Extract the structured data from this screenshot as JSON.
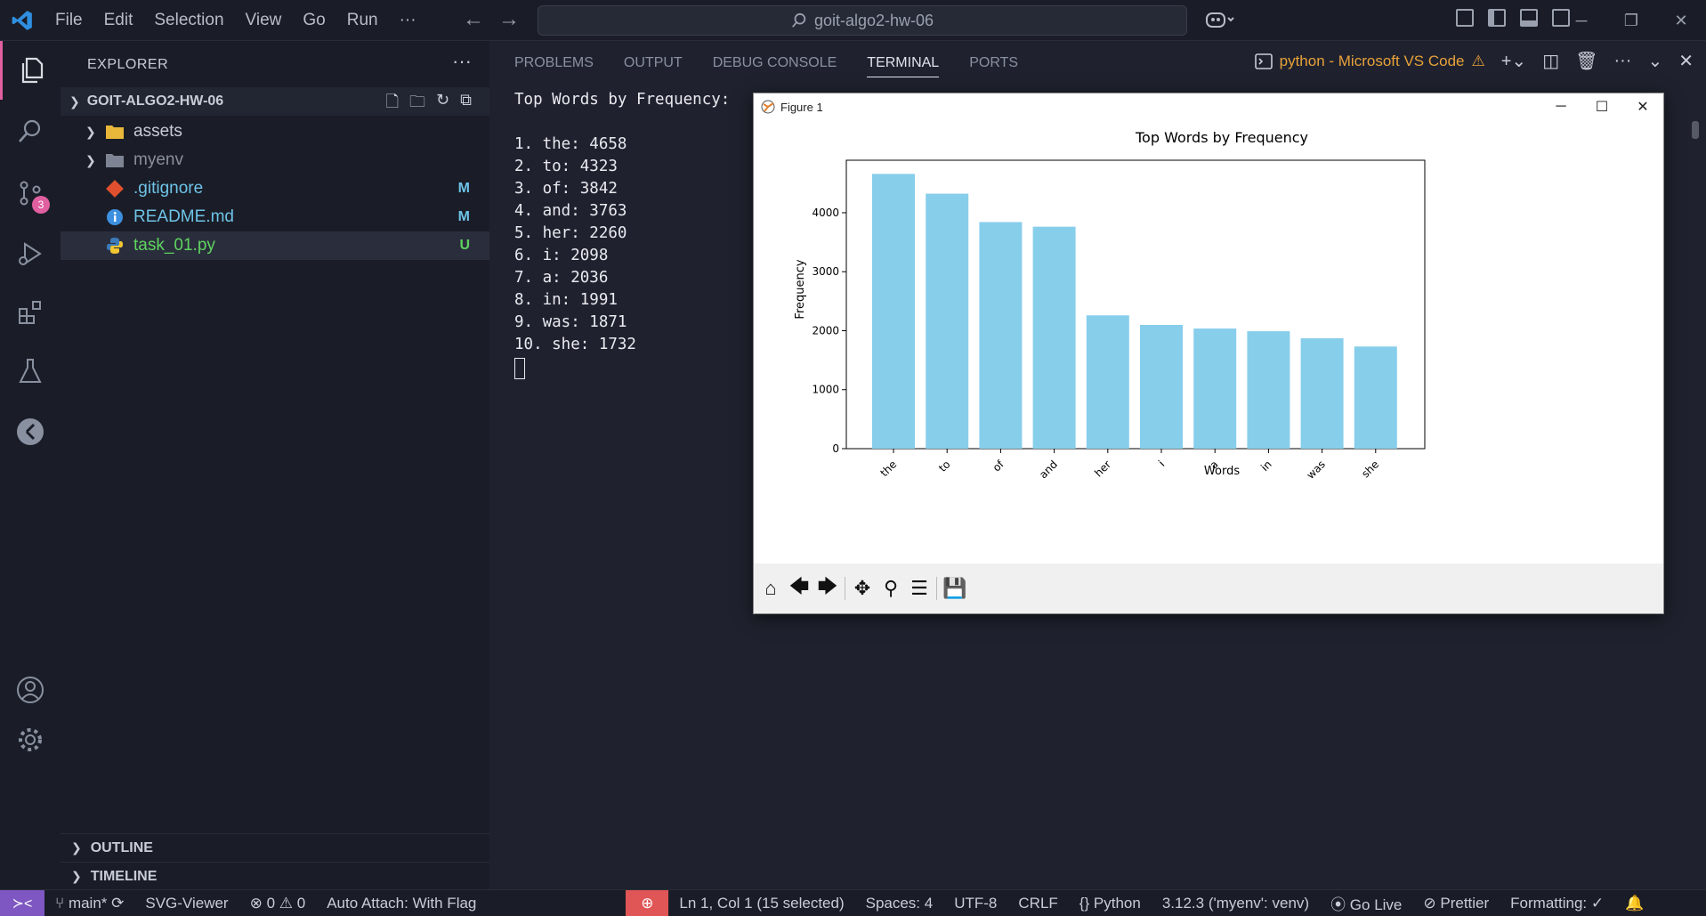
{
  "window": {
    "menu": [
      "File",
      "Edit",
      "Selection",
      "View",
      "Go",
      "Run",
      "···"
    ],
    "search_text": "goit-algo2-hw-06"
  },
  "activity": {
    "scm_badge": "3"
  },
  "sidebar": {
    "header": "EXPLORER",
    "folder_name": "GOIT-ALGO2-HW-06",
    "items": [
      {
        "name": "assets",
        "type": "folder",
        "status": "",
        "color": "#c8ccd6"
      },
      {
        "name": "myenv",
        "type": "folder",
        "status": "",
        "color": "#8a8f9c"
      },
      {
        "name": ".gitignore",
        "type": "git",
        "status": "M",
        "color": "#6ec3e8"
      },
      {
        "name": "README.md",
        "type": "info",
        "status": "M",
        "color": "#6ec3e8"
      },
      {
        "name": "task_01.py",
        "type": "python",
        "status": "U",
        "color": "#5fd35f"
      }
    ],
    "sections": [
      "OUTLINE",
      "TIMELINE"
    ]
  },
  "panel": {
    "tabs": [
      "PROBLEMS",
      "OUTPUT",
      "DEBUG CONSOLE",
      "TERMINAL",
      "PORTS"
    ],
    "active_tab": "TERMINAL",
    "terminal_name": "python - Microsoft VS Code",
    "terminal_lines": [
      "Top Words by Frequency:",
      "",
      "1. the: 4658",
      "2. to: 4323",
      "3. of: 3842",
      "4. and: 3763",
      "5. her: 2260",
      "6. i: 2098",
      "7. a: 2036",
      "8. in: 1991",
      "9. was: 1871",
      "10. she: 1732"
    ]
  },
  "figure": {
    "window_title": "Figure 1"
  },
  "chart_data": {
    "type": "bar",
    "title": "Top Words by Frequency",
    "xlabel": "Words",
    "ylabel": "Frequency",
    "categories": [
      "the",
      "to",
      "of",
      "and",
      "her",
      "i",
      "a",
      "in",
      "was",
      "she"
    ],
    "values": [
      4658,
      4323,
      3842,
      3763,
      2260,
      2098,
      2036,
      1991,
      1871,
      1732
    ],
    "ylim": [
      0,
      4890
    ],
    "yticks": [
      0,
      1000,
      2000,
      3000,
      4000
    ],
    "bar_color": "#87ceeb",
    "grid": false
  },
  "statusbar": {
    "branch": "main*",
    "svg_viewer": "SVG-Viewer",
    "errors": "0",
    "warnings": "0",
    "auto_attach": "Auto Attach: With Flag",
    "position": "Ln 1, Col 1 (15 selected)",
    "spaces": "Spaces: 4",
    "encoding": "UTF-8",
    "eol": "CRLF",
    "language": "Python",
    "interpreter": "3.12.3 ('myenv': venv)",
    "go_live": "Go Live",
    "prettier": "Prettier",
    "formatting": "Formatting: ✓"
  }
}
